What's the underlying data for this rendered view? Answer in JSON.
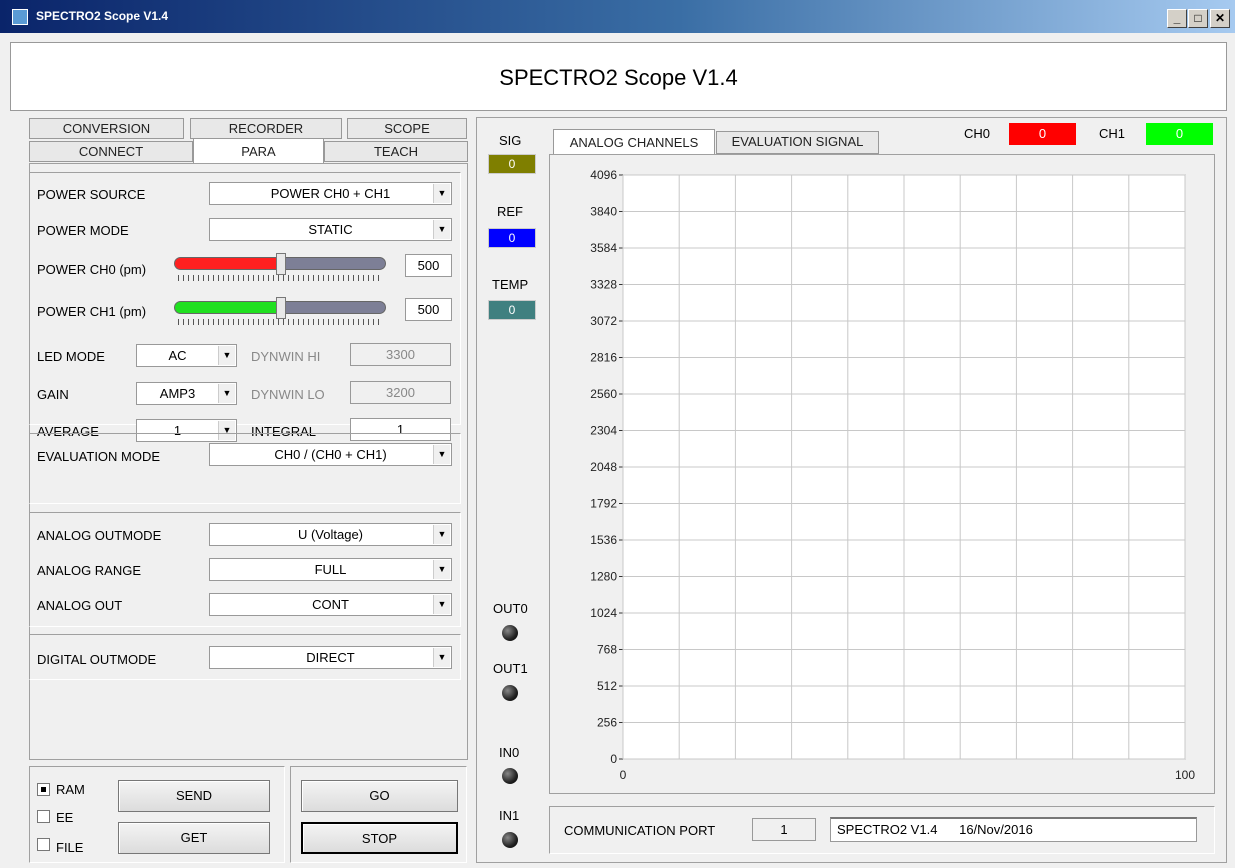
{
  "window": {
    "title": "SPECTRO2 Scope V1.4",
    "minimize": "_",
    "maximize": "□",
    "close": "✕",
    "icon": "app-icon"
  },
  "header": {
    "title": "SPECTRO2 Scope V1.4"
  },
  "left_tabs": {
    "row1": [
      "CONVERSION",
      "RECORDER",
      "SCOPE"
    ],
    "row2": [
      "CONNECT",
      "PARA",
      "TEACH"
    ],
    "active": "PARA"
  },
  "para": {
    "power_source": {
      "label": "POWER SOURCE",
      "value": "POWER CH0 + CH1"
    },
    "power_mode": {
      "label": "POWER MODE",
      "value": "STATIC"
    },
    "power_ch0": {
      "label": "POWER CH0 (pm)",
      "value": "500",
      "fraction": 0.5,
      "color": "#ff2020"
    },
    "power_ch1": {
      "label": "POWER CH1 (pm)",
      "value": "500",
      "fraction": 0.5,
      "color": "#20e020"
    },
    "led_mode": {
      "label": "LED MODE",
      "value": "AC"
    },
    "dynwin_hi": {
      "label": "DYNWIN HI",
      "value": "3300"
    },
    "gain": {
      "label": "GAIN",
      "value": "AMP3"
    },
    "dynwin_lo": {
      "label": "DYNWIN LO",
      "value": "3200"
    },
    "average": {
      "label": "AVERAGE",
      "value": "1"
    },
    "integral": {
      "label": "INTEGRAL",
      "value": "1"
    },
    "evaluation_mode": {
      "label": "EVALUATION MODE",
      "value": "CH0 / (CH0 + CH1)"
    },
    "analog_outmode": {
      "label": "ANALOG OUTMODE",
      "value": "U (Voltage)"
    },
    "analog_range": {
      "label": "ANALOG RANGE",
      "value": "FULL"
    },
    "analog_out": {
      "label": "ANALOG OUT",
      "value": "CONT"
    },
    "digital_outmode": {
      "label": "DIGITAL OUTMODE",
      "value": "DIRECT"
    }
  },
  "storage": {
    "ram": "RAM",
    "ee": "EE",
    "file": "FILE",
    "ram_checked": true
  },
  "buttons": {
    "send": "SEND",
    "get": "GET",
    "go": "GO",
    "stop": "STOP"
  },
  "indicators": {
    "sig": {
      "label": "SIG",
      "value": "0",
      "color": "#7f7f00"
    },
    "ref": {
      "label": "REF",
      "value": "0",
      "color": "#0000ff"
    },
    "temp": {
      "label": "TEMP",
      "value": "0",
      "color": "#408080"
    }
  },
  "leds": {
    "out0": "OUT0",
    "out1": "OUT1",
    "in0": "IN0",
    "in1": "IN1"
  },
  "chart_tabs": {
    "analog": "ANALOG CHANNELS",
    "evaluation": "EVALUATION SIGNAL",
    "active": "ANALOG CHANNELS"
  },
  "channels": {
    "ch0": {
      "label": "CH0",
      "value": "0",
      "color": "#ff0000"
    },
    "ch1": {
      "label": "CH1",
      "value": "0",
      "color": "#00ff00"
    }
  },
  "chart_data": {
    "type": "line",
    "xlabel": "",
    "ylabel": "",
    "xlim": [
      0,
      100
    ],
    "ylim": [
      0,
      4096
    ],
    "x_ticks": [
      "0",
      "100"
    ],
    "y_ticks": [
      0,
      256,
      512,
      768,
      1024,
      1280,
      1536,
      1792,
      2048,
      2304,
      2560,
      2816,
      3072,
      3328,
      3584,
      3840,
      4096
    ],
    "grid": true,
    "series": []
  },
  "comm": {
    "label": "COMMUNICATION PORT",
    "port": "1",
    "status": "SPECTRO2 V1.4      16/Nov/2016"
  }
}
